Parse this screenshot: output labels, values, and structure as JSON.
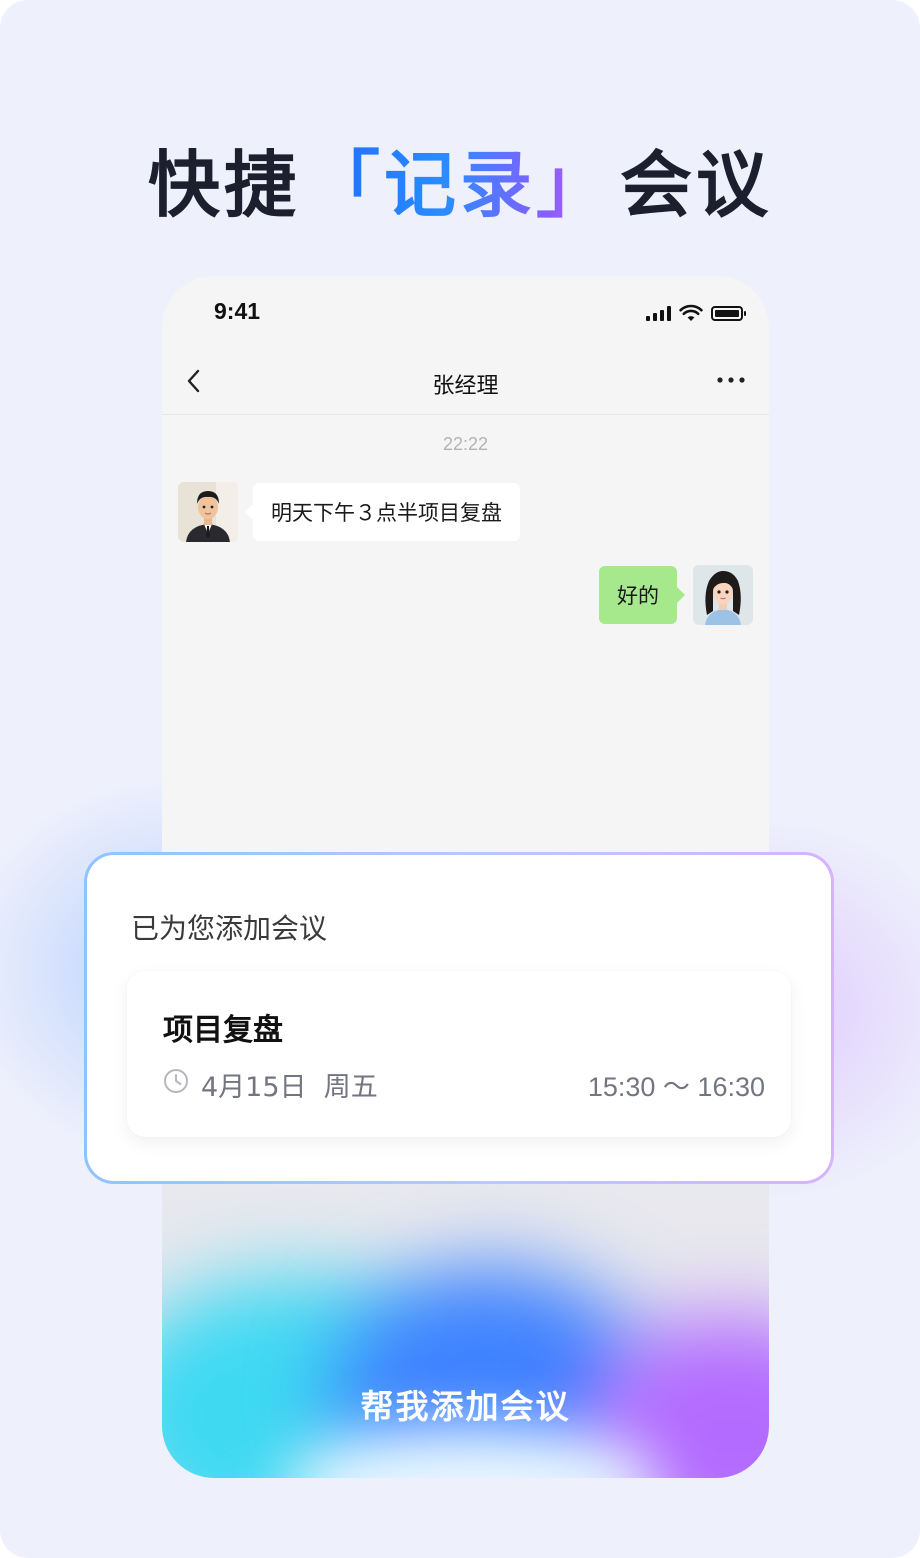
{
  "headline": {
    "prefix": "快捷",
    "highlight": "「记录」",
    "suffix": "会议"
  },
  "status_bar": {
    "time": "9:41",
    "icons": [
      "signal-icon",
      "wifi-icon",
      "battery-icon"
    ]
  },
  "chat": {
    "title": "张经理",
    "timestamp": "22:22",
    "messages": [
      {
        "from": "contact",
        "avatar": "male-avatar",
        "text": "明天下午３点半项目复盘"
      },
      {
        "from": "me",
        "avatar": "female-avatar",
        "text": "好的"
      }
    ]
  },
  "popup": {
    "title": "已为您添加会议",
    "event": {
      "name": "项目复盘",
      "date": "4月15日  周五",
      "time": "15:30 ～ 16:30"
    }
  },
  "cta": {
    "label": "帮我添加会议"
  },
  "colors": {
    "page_bg": "#eef0fc",
    "headline_text": "#1c1f2e",
    "highlight_gradient": [
      "#1e6cff",
      "#8a5cff",
      "#c86bff"
    ],
    "my_bubble": "#a6e88c",
    "contact_bubble": "#ffffff",
    "card_border_gradient": [
      "#8fc3ff",
      "#d5b3ff"
    ]
  }
}
